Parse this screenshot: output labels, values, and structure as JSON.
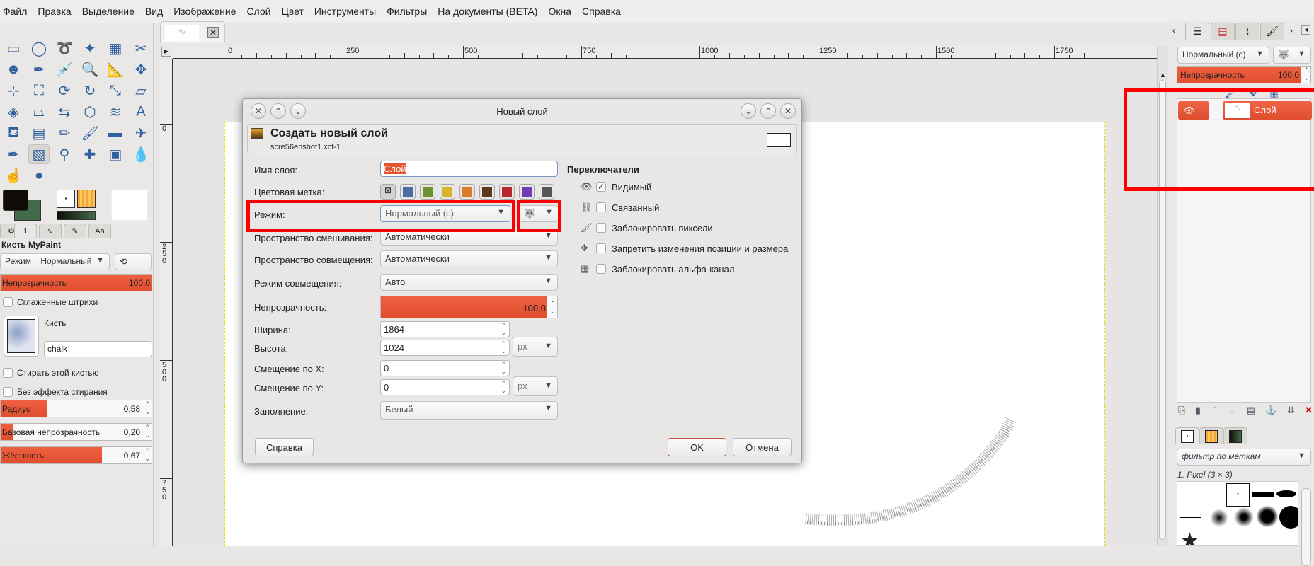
{
  "menu": [
    "Файл",
    "Правка",
    "Выделение",
    "Вид",
    "Изображение",
    "Слой",
    "Цвет",
    "Инструменты",
    "Фильтры",
    "На документы (BETA)",
    "Окна",
    "Справка"
  ],
  "toolbox": {
    "tools": [
      "rect-select-icon",
      "ellipse-select-icon",
      "lasso-icon",
      "fuzzy-select-icon",
      "select-by-color-icon",
      "scissors-icon",
      "foreground-select-icon",
      "paths-icon",
      "color-picker-icon",
      "zoom-icon",
      "measure-icon",
      "move-icon",
      "align-icon",
      "crop-icon",
      "unified-transform-icon",
      "rotate-icon",
      "scale-icon",
      "shear-icon",
      "handle-transform-icon",
      "perspective-icon",
      "flip-icon",
      "cage-icon",
      "warp-icon",
      "text-icon",
      "bucket-fill-icon",
      "gradient-icon",
      "pencil-icon",
      "paintbrush-icon",
      "eraser-icon",
      "airbrush-icon",
      "ink-icon",
      "mypaint-brush-icon",
      "clone-icon",
      "heal-icon",
      "perspective-clone-icon",
      "blur-icon",
      "smudge-icon",
      "dodge-burn-icon"
    ],
    "tool_glyphs": [
      "▭",
      "◯",
      "➰",
      "✦",
      "▦",
      "✂",
      "☻",
      "✒",
      "💉",
      "🔍",
      "📐",
      "✥",
      "⊹",
      "⛶",
      "⟳",
      "↻",
      "⤡",
      "▱",
      "◈",
      "⏢",
      "⇆",
      "⬡",
      "≋",
      "A",
      "⛾",
      "▤",
      "✏",
      "🖌",
      "▬",
      "✈",
      "✒",
      "▧",
      "⚲",
      "✚",
      "▣",
      "💧",
      "☝",
      "●"
    ],
    "active_tool": 31,
    "fg_color": "#0f0b06",
    "bg_color": "#416b4b",
    "panel_title": "Кисть MyPaint",
    "mode_label": "Режим",
    "mode_value": "Нормальный",
    "opacity_label": "Непрозрачность",
    "opacity_value": "100,0",
    "opacity_fraction": 1.0,
    "smooth_label": "Сглаженные штрихи",
    "brush_label": "Кисть",
    "brush_value": "chalk",
    "erase_label": "Стирать этой кистью",
    "no_erase_label": "Без эффекта стирания",
    "sliders": [
      {
        "label": "Радиус",
        "value": "0,58",
        "fraction": 0.31
      },
      {
        "label": "Базовая непрозрачность",
        "value": "0,20",
        "fraction": 0.08
      },
      {
        "label": "Жёсткость",
        "value": "0,67",
        "fraction": 0.67
      }
    ]
  },
  "ruler": {
    "top": [
      "0",
      "250",
      "500",
      "750",
      "1000",
      "1250",
      "1500",
      "1750"
    ],
    "left": [
      "0",
      "250",
      "500",
      "750"
    ]
  },
  "dialog": {
    "title": "Новый слой",
    "header_title": "Создать новый слой",
    "header_sub": "scre56enshot1.xcf-1",
    "layer_name_label": "Имя слоя:",
    "layer_name_value": "Слой",
    "color_tag_label": "Цветовая метка:",
    "color_tags": [
      "#4f6aa8",
      "#6b9330",
      "#d4b52b",
      "#dd7a27",
      "#5a3a1a",
      "#b8282e",
      "#6e3db3",
      "#565656"
    ],
    "mode_label": "Режим:",
    "mode_value": "Нормальный (c)",
    "blend_space_label": "Пространство смешивания:",
    "blend_space_value": "Автоматически",
    "composite_space_label": "Пространство совмещения:",
    "composite_space_value": "Автоматически",
    "composite_mode_label": "Режим совмещения:",
    "composite_mode_value": "Авто",
    "opacity_label": "Непрозрачность:",
    "opacity_value": "100,0",
    "width_label": "Ширина:",
    "width_value": "1864",
    "height_label": "Высота:",
    "height_value": "1024",
    "unit": "px",
    "offx_label": "Смещение по X:",
    "offx_value": "0",
    "offy_label": "Смещение по Y:",
    "offy_value": "0",
    "offset_unit": "px",
    "fill_label": "Заполнение:",
    "fill_value": "Белый",
    "switches_title": "Переключатели",
    "switches": [
      {
        "label": "Видимый",
        "checked": true
      },
      {
        "label": "Связанный",
        "checked": false
      },
      {
        "label": "Заблокировать пиксели",
        "checked": false
      },
      {
        "label": "Запретить изменения позиции и размера",
        "checked": false
      },
      {
        "label": "Заблокировать альфа-канал",
        "checked": false
      }
    ],
    "help_button": "Справка",
    "ok_button": "OK",
    "cancel_button": "Отмена"
  },
  "layers_panel": {
    "mode_value": "Нормальный (c)",
    "opacity_label": "Непрозрачность",
    "opacity_value": "100,0",
    "layer_name": "Слой",
    "brushes_filter": "фильтр по меткам",
    "brush_name": "1. Pixel (3 × 3)"
  },
  "colors": {
    "accent": "#e4542f",
    "highlight": "#ff0000"
  }
}
